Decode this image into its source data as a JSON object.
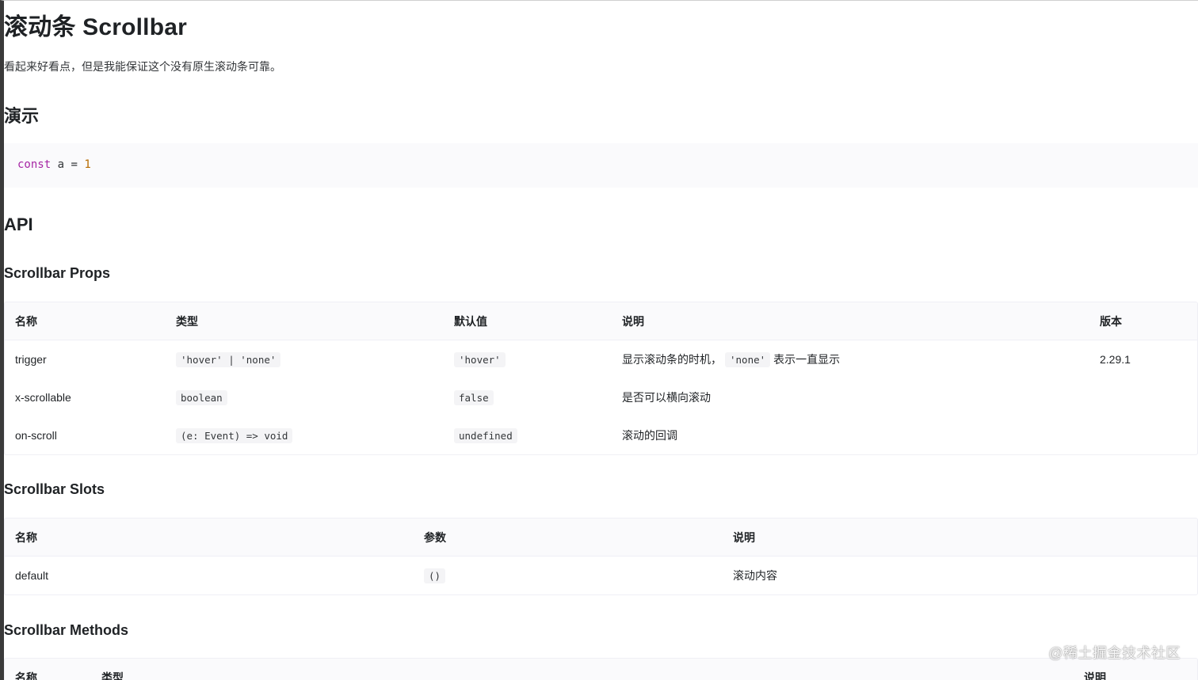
{
  "page": {
    "title": "滚动条 Scrollbar",
    "intro": "看起来好看点，但是我能保证这个没有原生滚动条可靠。"
  },
  "demo": {
    "heading": "演示",
    "code": {
      "keyword": "const",
      "rest": " a = ",
      "number": "1"
    }
  },
  "api": {
    "heading": "API",
    "props": {
      "heading": "Scrollbar Props",
      "columns": [
        "名称",
        "类型",
        "默认值",
        "说明",
        "版本"
      ],
      "rows": [
        {
          "name": "trigger",
          "type": "'hover' | 'none'",
          "default": "'hover'",
          "desc_before": "显示滚动条的时机，",
          "desc_code": "'none'",
          "desc_after": "表示一直显示",
          "version": "2.29.1"
        },
        {
          "name": "x-scrollable",
          "type": "boolean",
          "default": "false",
          "desc": "是否可以横向滚动",
          "version": ""
        },
        {
          "name": "on-scroll",
          "type": "(e: Event) => void",
          "default": "undefined",
          "desc": "滚动的回调",
          "version": ""
        }
      ]
    },
    "slots": {
      "heading": "Scrollbar Slots",
      "columns": [
        "名称",
        "参数",
        "说明"
      ],
      "rows": [
        {
          "name": "default",
          "params": "()",
          "desc": "滚动内容"
        }
      ]
    },
    "methods": {
      "heading": "Scrollbar Methods",
      "columns": [
        "名称",
        "类型",
        "说明"
      ]
    }
  },
  "watermark": "@稀土掘金技术社区"
}
